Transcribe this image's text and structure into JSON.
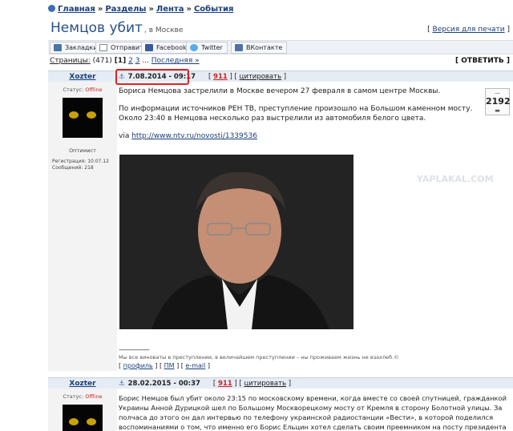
{
  "breadcrumb": {
    "items": [
      "Главная",
      "Разделы",
      "Лента",
      "События"
    ]
  },
  "topic": {
    "title": "Немцов убит",
    "subtitle": ", в Москве",
    "print_link": "Версия для печати"
  },
  "share": {
    "buttons": [
      {
        "label": "Закладки",
        "icon": "bookmark-icon",
        "color": "#4a76a8"
      },
      {
        "label": "Отправить",
        "icon": "mail-icon",
        "color": "#8a8a8a"
      },
      {
        "label": "Facebook",
        "icon": "facebook-icon",
        "color": "#3b5998"
      },
      {
        "label": "Twitter",
        "icon": "twitter-icon",
        "color": "#55acee"
      },
      {
        "label": "ВКонтакте",
        "icon": "vk-icon",
        "color": "#4c75a3"
      }
    ]
  },
  "pagination": {
    "label": "Страницы:",
    "count": "(471)",
    "current": "[1]",
    "page2": "2",
    "page3": "3",
    "ellipsis": "...",
    "last": "Последняя »"
  },
  "reply": {
    "label": "[ ОТВЕТИТЬ ]"
  },
  "posts": [
    {
      "author": "Xozter",
      "status_label": "Статус:",
      "status_value": "Offline",
      "rank": "Оптимист",
      "reg_label": "Регистрация:",
      "reg_date": "10.07.12",
      "msgs_label": "Сообщений:",
      "msgs_count": "218",
      "date": "7.08.2014 - 09:17",
      "post_no": "911",
      "quote": "цитировать",
      "rating": "2192",
      "paragraphs": [
        "Бориса Немцова застрелили в Москве вечером 27 февраля в самом центре Москвы.",
        "По информации источников РЕН ТВ, преступление произошло на Большом каменном мосту. Около 23:40 в Немцова несколько раз выстрелили из автомобиля белого цвета."
      ],
      "via_label": "via",
      "via_link": "http://www.ntv.ru/novosti/1339536",
      "signature": "Мы все виноваты в преступлении, в величайшем преступлении – ны проживаем жизнь не взахлеб.©",
      "links": [
        "профиль",
        "ПМ",
        "e-mail"
      ]
    },
    {
      "author": "Xozter",
      "status_label": "Статус:",
      "status_value": "Offline",
      "date": "28.02.2015 - 00:37",
      "post_no": "911",
      "quote": "цитировать",
      "text": "Борис Немцов был убит около 23:15 по московскому времени, когда вместе со своей спутницей, гражданкой Украины Анной Дурицкой шел по Большому Москворецкому мосту от Кремля в сторону Болотной улицы. За полчаса до этого он дал интервью по телефону украинской радиостанции «Вести», в которой поделился воспоминаниями о том, что именно его Борис Ельцин хотел сделать своим преемником на посту президента России, но потом"
    }
  ],
  "watermark": "YAPLAKAL.COM"
}
